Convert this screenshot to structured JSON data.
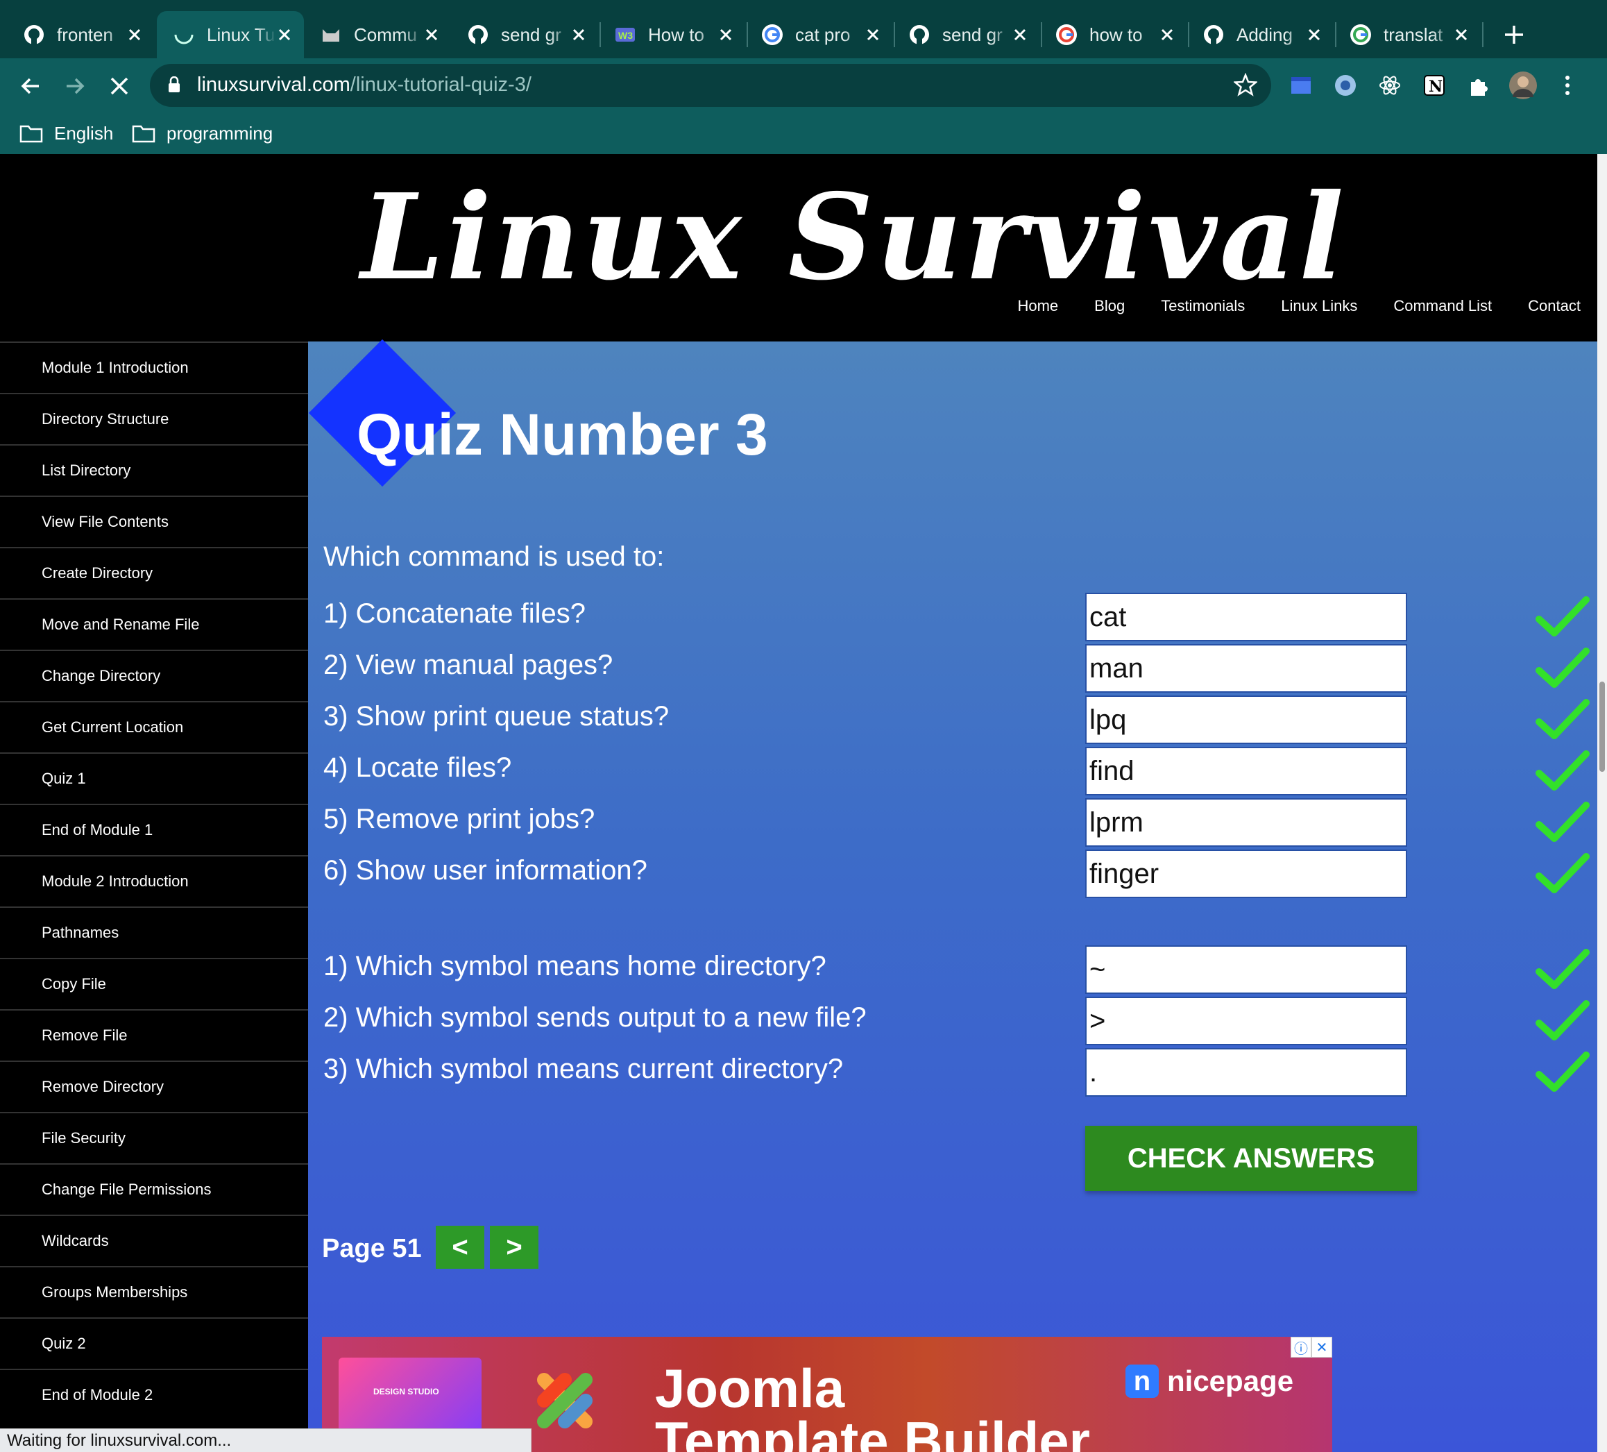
{
  "browser": {
    "tabs": [
      {
        "title": "fronten",
        "icon": "github-icon"
      },
      {
        "title": "Linux Tu",
        "icon": "loading-spinner-icon",
        "active": true
      },
      {
        "title": "Commu",
        "icon": "cat-icon"
      },
      {
        "title": "send gr",
        "icon": "github-icon"
      },
      {
        "title": "How to",
        "icon": "w3-icon"
      },
      {
        "title": "cat pro",
        "icon": "google-icon"
      },
      {
        "title": "send gr",
        "icon": "github-icon"
      },
      {
        "title": "how to",
        "icon": "google-icon"
      },
      {
        "title": "Adding",
        "icon": "github-icon"
      },
      {
        "title": "translat",
        "icon": "google-icon"
      }
    ],
    "address": {
      "host": "linuxsurvival.com",
      "path": "/linux-tutorial-quiz-3/"
    },
    "bookmarks": [
      {
        "label": "English"
      },
      {
        "label": "programming"
      }
    ],
    "status_text": "Waiting for linuxsurvival.com..."
  },
  "site": {
    "logo": "Linux Survival",
    "nav": [
      "Home",
      "Blog",
      "Testimonials",
      "Linux Links",
      "Command List",
      "Contact"
    ]
  },
  "sidebar": {
    "items": [
      "Module 1 Introduction",
      "Directory Structure",
      "List Directory",
      "View File Contents",
      "Create Directory",
      "Move and Rename File",
      "Change Directory",
      "Get Current Location",
      "Quiz 1",
      "End of Module 1",
      "Module 2 Introduction",
      "Pathnames",
      "Copy File",
      "Remove File",
      "Remove Directory",
      "File Security",
      "Change File Permissions",
      "Wildcards",
      "Groups Memberships",
      "Quiz 2",
      "End of Module 2"
    ]
  },
  "quiz": {
    "title": "Quiz Number 3",
    "prompt": "Which command is used to:",
    "commands": [
      {
        "q": "1) Concatenate files?",
        "a": "cat"
      },
      {
        "q": "2) View manual pages?",
        "a": "man"
      },
      {
        "q": "3) Show print queue status?",
        "a": "lpq"
      },
      {
        "q": "4) Locate files?",
        "a": "find"
      },
      {
        "q": "5) Remove print jobs?",
        "a": "lprm"
      },
      {
        "q": "6) Show user information?",
        "a": "finger"
      }
    ],
    "symbols": [
      {
        "q": "1) Which symbol means home directory?",
        "a": "~"
      },
      {
        "q": "2) Which symbol sends output to a new file?",
        "a": ">"
      },
      {
        "q": "3) Which symbol means current directory?",
        "a": "."
      }
    ],
    "check_label": "CHECK ANSWERS",
    "page_label": "Page 51",
    "prev_label": "<",
    "next_label": ">"
  },
  "ad": {
    "thumb_text": "DESIGN STUDIO",
    "title": "Joomla\nTemplate Builder",
    "brand": "nicepage",
    "brand_mark": "n"
  },
  "colors": {
    "tabstrip": "#07403f",
    "toolbar": "#0e5d5d",
    "check_green": "#2d8a1f",
    "tick_green": "#33e02a",
    "badge_blue": "#1433ff"
  }
}
